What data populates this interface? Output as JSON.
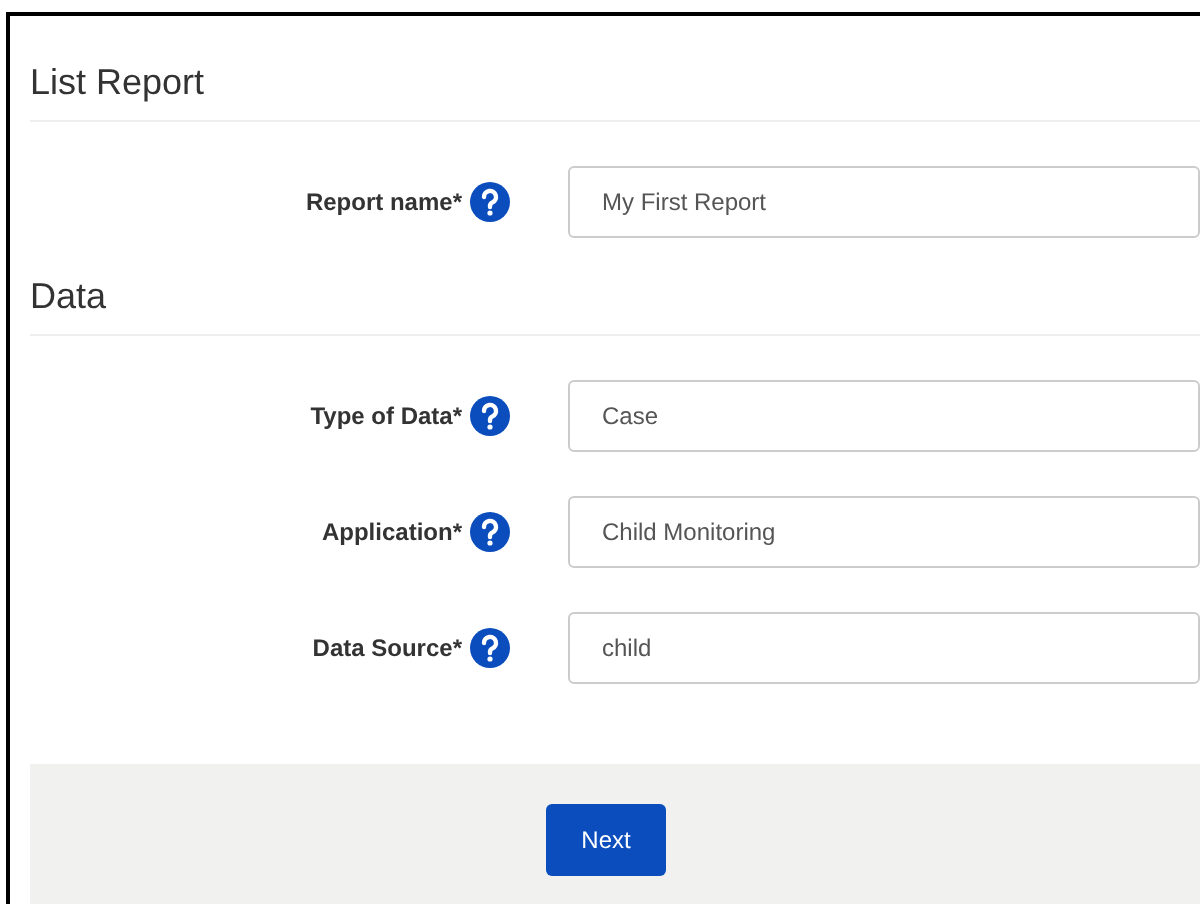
{
  "sections": [
    {
      "title": "List Report",
      "fields": [
        {
          "label": "Report name*",
          "value": "My First Report"
        }
      ]
    },
    {
      "title": "Data",
      "fields": [
        {
          "label": "Type of Data*",
          "value": "Case"
        },
        {
          "label": "Application*",
          "value": "Child Monitoring"
        },
        {
          "label": "Data Source*",
          "value": "child"
        }
      ]
    }
  ],
  "footer": {
    "button": "Next"
  }
}
